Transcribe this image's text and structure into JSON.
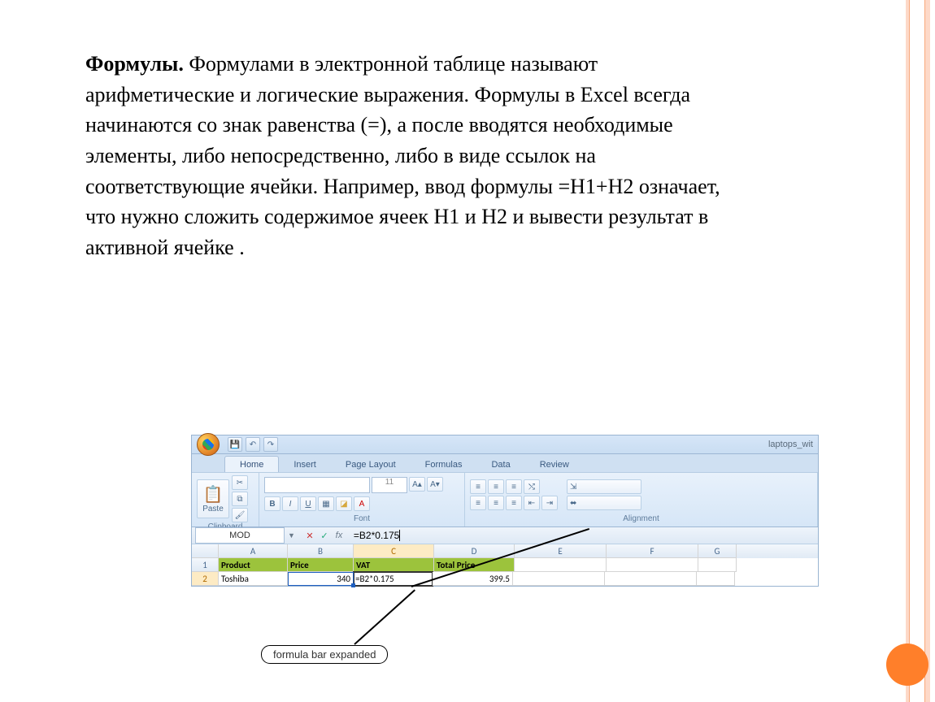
{
  "body": {
    "bold_lead": "Формулы.",
    "text": " Формулами в электронной таблице называют арифметические и логические выражения. Формулы в Excel всегда начинаются со знак равенства (=), а после вводятся необходимые элементы, либо непосредственно, либо в виде ссылок на соответствующие ячейки. Например, ввод формулы =H1+H2 означает, что нужно сложить содержимое ячеек H1 и H2 и вывести результат в активной ячейке ."
  },
  "excel": {
    "title_right": "laptops_wit",
    "tabs": [
      "Home",
      "Insert",
      "Page Layout",
      "Formulas",
      "Data",
      "Review"
    ],
    "paste_label": "Paste",
    "groups": {
      "clipboard": "Clipboard",
      "font": "Font",
      "alignment": "Alignment"
    },
    "font_size": "11",
    "name_box": "MOD",
    "formula": "=B2*0.175",
    "columns": [
      "A",
      "B",
      "C",
      "D",
      "E",
      "F",
      "G"
    ],
    "row1": {
      "A": "Product",
      "B": "Price",
      "C": "VAT",
      "D": "Total Price"
    },
    "row2": {
      "A": "Toshiba",
      "B": "340",
      "C": "=B2*0.175",
      "D": "399.5"
    },
    "callout": "formula bar expanded"
  }
}
